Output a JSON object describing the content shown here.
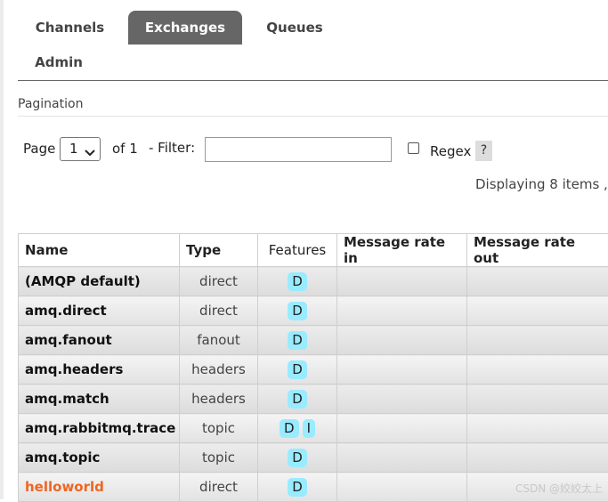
{
  "tabs": [
    {
      "label": "Channels"
    },
    {
      "label": "Exchanges",
      "active": true
    },
    {
      "label": "Queues"
    },
    {
      "label": "Admin"
    }
  ],
  "pagination": {
    "section_title": "Pagination",
    "page_label": "Page",
    "page_value": "1",
    "of_label": "of 1",
    "filter_label": "- Filter:",
    "filter_value": "",
    "regex_label": "Regex",
    "regex_checked": false,
    "help_label": "?",
    "displaying": "Displaying 8 items ,"
  },
  "table": {
    "columns": [
      "Name",
      "Type",
      "Features",
      "Message rate in",
      "Message rate out"
    ],
    "rows": [
      {
        "name": "(AMQP default)",
        "type": "direct",
        "features": [
          "D"
        ],
        "rate_in": "",
        "rate_out": ""
      },
      {
        "name": "amq.direct",
        "type": "direct",
        "features": [
          "D"
        ],
        "rate_in": "",
        "rate_out": ""
      },
      {
        "name": "amq.fanout",
        "type": "fanout",
        "features": [
          "D"
        ],
        "rate_in": "",
        "rate_out": ""
      },
      {
        "name": "amq.headers",
        "type": "headers",
        "features": [
          "D"
        ],
        "rate_in": "",
        "rate_out": ""
      },
      {
        "name": "amq.match",
        "type": "headers",
        "features": [
          "D"
        ],
        "rate_in": "",
        "rate_out": ""
      },
      {
        "name": "amq.rabbitmq.trace",
        "type": "topic",
        "features": [
          "D",
          "I"
        ],
        "rate_in": "",
        "rate_out": ""
      },
      {
        "name": "amq.topic",
        "type": "topic",
        "features": [
          "D"
        ],
        "rate_in": "",
        "rate_out": ""
      },
      {
        "name": "helloworld",
        "type": "direct",
        "features": [
          "D"
        ],
        "rate_in": "",
        "rate_out": "",
        "highlight": true
      }
    ]
  },
  "watermark": "CSDN @姣姣太上",
  "colors": {
    "active_tab": "#666666",
    "badge": "#99ebff",
    "link": "#ee6622"
  }
}
